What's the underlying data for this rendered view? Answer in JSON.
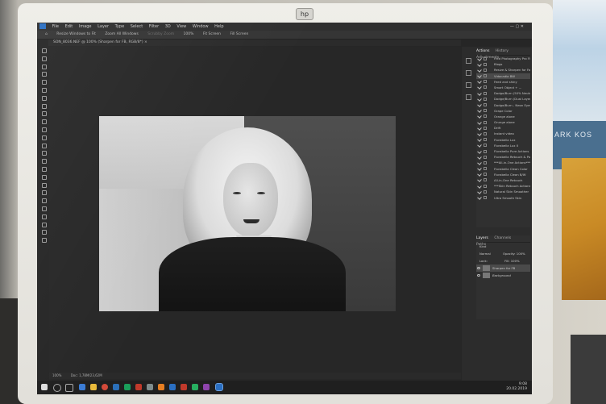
{
  "menubar": {
    "items": [
      "File",
      "Edit",
      "Image",
      "Layer",
      "Type",
      "Select",
      "Filter",
      "3D",
      "View",
      "Window",
      "Help"
    ],
    "window_controls": "— ▢ ✕"
  },
  "optionsbar": {
    "items": [
      "Resize Windows to Fit",
      "Zoom All Windows",
      "Scrubby Zoom",
      "100%",
      "Fit Screen",
      "Fill Screen"
    ]
  },
  "document_tab": {
    "title": "SON_8036.NEF @ 100% (Sharpen for FB, RGB/8*) ×"
  },
  "actions_panel": {
    "tabs": [
      "Actions",
      "History",
      "Adjustments"
    ],
    "items": [
      "Fred Photography Pro Fi...",
      "Blogs",
      "Resize & Sharpen for Face...",
      "Vidacadia BW",
      "Feed and shiny",
      "Smart Object + ...",
      "Dodge/Burn (50% Neutral...",
      "Dodge/Burn (Dual Layer)",
      "Dodge/Burn - Neon Eyes",
      "Grape Color",
      "Orange alone",
      "Grunge alone",
      "Drift",
      "Instant video",
      "Florabella Lux",
      "Florabella Lux II",
      "Florabella Pure Actions",
      "Florabella Retouch & Pol...",
      "***All-in-One Actions***",
      "Florabella Clean Color",
      "Florabella Clean B/W",
      "All-in-One Retouch",
      "***Skin Retouch Actions***",
      "Natural Skin Smoother",
      "Ultra Smooth Skin"
    ],
    "selected_index": 3
  },
  "layers_panel": {
    "tabs": [
      "Layers",
      "Channels",
      "Paths"
    ],
    "kind_label": "Kind",
    "blend_mode": "Normal",
    "opacity_label": "Opacity:",
    "opacity_value": "100%",
    "lock_label": "Lock:",
    "fill_label": "Fill:",
    "fill_value": "100%",
    "layers": [
      "Sharpen for FB",
      "Background"
    ]
  },
  "statusbar": {
    "zoom": "100%",
    "doc": "Doc: 1,78M/23,62M"
  },
  "taskbar": {
    "time": "9:08",
    "date": "20.02.2019"
  },
  "hp_logo": "hp",
  "poster": {
    "text": "ARK  KOS"
  },
  "colors": {
    "ps_blue": "#2a6fc2",
    "ui_dark": "#2c2c2c",
    "panel": "#303030"
  }
}
